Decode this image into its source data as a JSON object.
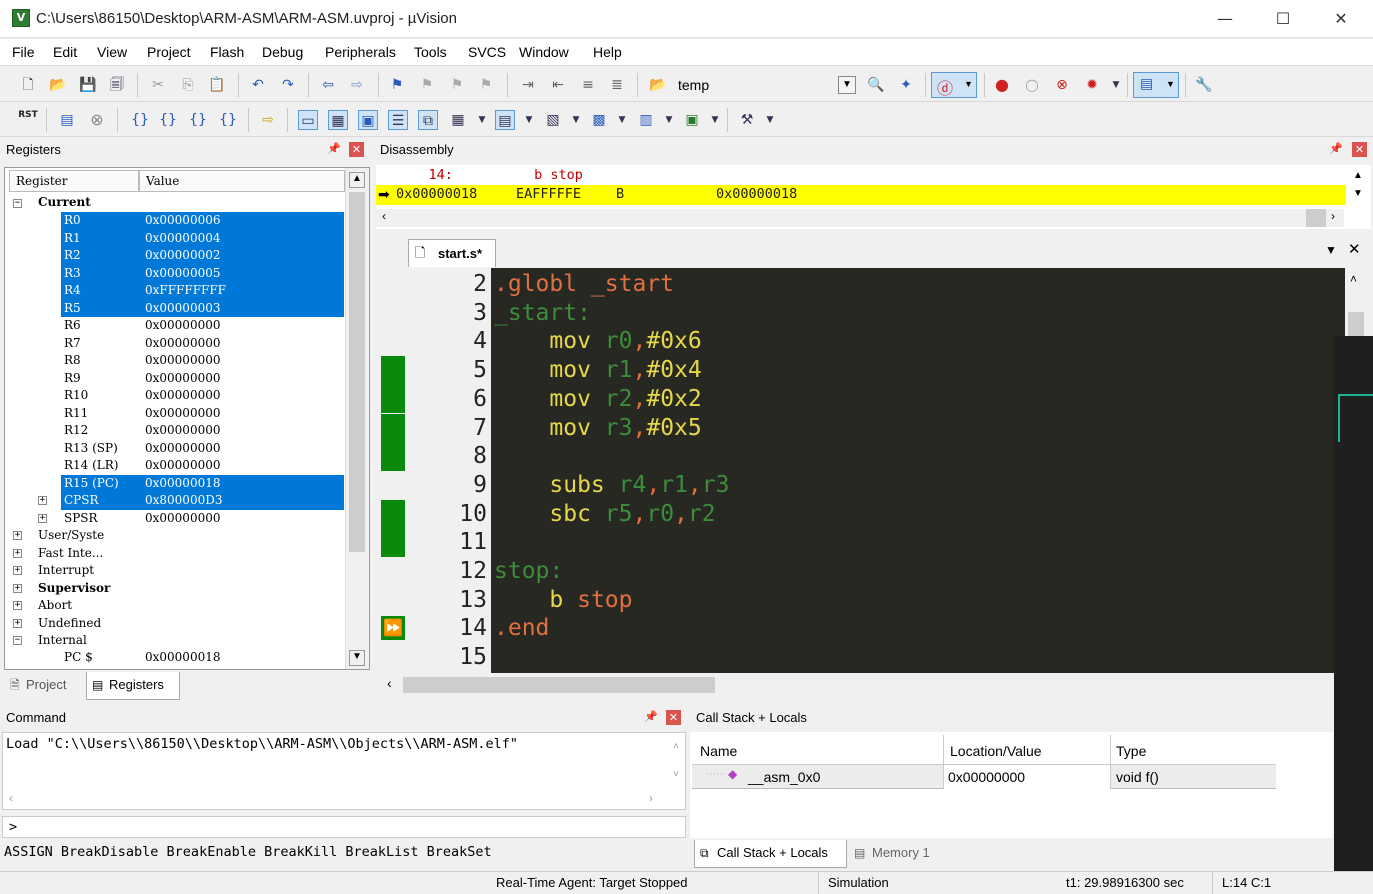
{
  "window": {
    "title": "C:\\Users\\86150\\Desktop\\ARM-ASM\\ARM-ASM.uvproj - µVision",
    "icon": "V"
  },
  "menu": [
    "File",
    "Edit",
    "View",
    "Project",
    "Flash",
    "Debug",
    "Peripherals",
    "Tools",
    "SVCS",
    "Window",
    "Help"
  ],
  "toolbar": {
    "target_combo": "temp"
  },
  "registers": {
    "title": "Registers",
    "col_register": "Register",
    "col_value": "Value",
    "current_label": "Current",
    "rows": [
      {
        "name": "R0",
        "value": "0x00000006",
        "selected": true
      },
      {
        "name": "R1",
        "value": "0x00000004",
        "selected": true
      },
      {
        "name": "R2",
        "value": "0x00000002",
        "selected": true
      },
      {
        "name": "R3",
        "value": "0x00000005",
        "selected": true
      },
      {
        "name": "R4",
        "value": "0xFFFFFFFF",
        "selected": true
      },
      {
        "name": "R5",
        "value": "0x00000003",
        "selected": true
      },
      {
        "name": "R6",
        "value": "0x00000000",
        "selected": false
      },
      {
        "name": "R7",
        "value": "0x00000000",
        "selected": false
      },
      {
        "name": "R8",
        "value": "0x00000000",
        "selected": false
      },
      {
        "name": "R9",
        "value": "0x00000000",
        "selected": false
      },
      {
        "name": "R10",
        "value": "0x00000000",
        "selected": false
      },
      {
        "name": "R11",
        "value": "0x00000000",
        "selected": false
      },
      {
        "name": "R12",
        "value": "0x00000000",
        "selected": false
      },
      {
        "name": "R13 (SP)",
        "value": "0x00000000",
        "selected": false
      },
      {
        "name": "R14 (LR)",
        "value": "0x00000000",
        "selected": false
      },
      {
        "name": "R15 (PC)",
        "value": "0x00000018",
        "selected": true
      },
      {
        "name": "CPSR",
        "value": "0x800000D3",
        "selected": true
      },
      {
        "name": "SPSR",
        "value": "0x00000000",
        "selected": false
      }
    ],
    "groups": [
      "User/Syste",
      "Fast Inte...",
      "Interrupt",
      "Supervisor",
      "Abort",
      "Undefined",
      "Internal"
    ],
    "pc_row": {
      "name": "PC  $",
      "value": "0x00000018"
    }
  },
  "left_tabs": {
    "project": "Project",
    "registers": "Registers"
  },
  "disassembly": {
    "title": "Disassembly",
    "line1": "    14:          b stop",
    "line2_addr": "0x00000018",
    "line2_opcode": "EAFFFFFE",
    "line2_instr": "B",
    "line2_target": "0x00000018"
  },
  "editor": {
    "tab": "start.s*",
    "lines": [
      {
        "n": "2",
        "tokens": [
          {
            "t": ".globl _start",
            "c": "#e07040"
          }
        ]
      },
      {
        "n": "3",
        "tokens": [
          {
            "t": "_start:",
            "c": "#3c8c3c"
          }
        ]
      },
      {
        "n": "4",
        "tokens": [
          {
            "t": "    mov ",
            "c": "#e6d84a"
          },
          {
            "t": "r0",
            "c": "#3c8c3c"
          },
          {
            "t": ",",
            "c": "#e07040"
          },
          {
            "t": "#0x6",
            "c": "#e6d84a"
          }
        ]
      },
      {
        "n": "5",
        "tokens": [
          {
            "t": "    mov ",
            "c": "#e6d84a"
          },
          {
            "t": "r1",
            "c": "#3c8c3c"
          },
          {
            "t": ",",
            "c": "#e07040"
          },
          {
            "t": "#0x4",
            "c": "#e6d84a"
          }
        ]
      },
      {
        "n": "6",
        "tokens": [
          {
            "t": "    mov ",
            "c": "#e6d84a"
          },
          {
            "t": "r2",
            "c": "#3c8c3c"
          },
          {
            "t": ",",
            "c": "#e07040"
          },
          {
            "t": "#0x2",
            "c": "#e6d84a"
          }
        ]
      },
      {
        "n": "7",
        "tokens": [
          {
            "t": "    mov ",
            "c": "#e6d84a"
          },
          {
            "t": "r3",
            "c": "#3c8c3c"
          },
          {
            "t": ",",
            "c": "#e07040"
          },
          {
            "t": "#0x5",
            "c": "#e6d84a"
          }
        ]
      },
      {
        "n": "8",
        "tokens": []
      },
      {
        "n": "9",
        "tokens": [
          {
            "t": "    subs ",
            "c": "#e6d84a"
          },
          {
            "t": "r4",
            "c": "#3c8c3c"
          },
          {
            "t": ",",
            "c": "#e07040"
          },
          {
            "t": "r1",
            "c": "#3c8c3c"
          },
          {
            "t": ",",
            "c": "#e07040"
          },
          {
            "t": "r3",
            "c": "#3c8c3c"
          }
        ]
      },
      {
        "n": "10",
        "tokens": [
          {
            "t": "    sbc ",
            "c": "#e6d84a"
          },
          {
            "t": "r5",
            "c": "#3c8c3c"
          },
          {
            "t": ",",
            "c": "#e07040"
          },
          {
            "t": "r0",
            "c": "#3c8c3c"
          },
          {
            "t": ",",
            "c": "#e07040"
          },
          {
            "t": "r2",
            "c": "#3c8c3c"
          }
        ]
      },
      {
        "n": "11",
        "tokens": []
      },
      {
        "n": "12",
        "tokens": [
          {
            "t": "stop:",
            "c": "#3c8c3c"
          }
        ]
      },
      {
        "n": "13",
        "tokens": [
          {
            "t": "    b ",
            "c": "#e6d84a"
          },
          {
            "t": "stop",
            "c": "#e07040"
          }
        ]
      },
      {
        "n": "14",
        "tokens": [
          {
            "t": ".end",
            "c": "#e07040"
          }
        ]
      },
      {
        "n": "15",
        "tokens": []
      }
    ]
  },
  "command": {
    "title": "Command",
    "output": "Load \"C:\\\\Users\\\\86150\\\\Desktop\\\\ARM-ASM\\\\Objects\\\\ARM-ASM.elf\"",
    "prompt": ">",
    "hints": "ASSIGN BreakDisable BreakEnable BreakKill BreakList BreakSet"
  },
  "callstack": {
    "title": "Call Stack + Locals",
    "col_name": "Name",
    "col_location": "Location/Value",
    "col_type": "Type",
    "row_name": "__asm_0x0",
    "row_location": "0x00000000",
    "row_type": "void f()",
    "tab_callstack": "Call Stack + Locals",
    "tab_memory": "Memory 1"
  },
  "status": {
    "agent": "Real-Time Agent: Target Stopped",
    "mode": "Simulation",
    "time": "t1: 29.98916300 sec",
    "position": "L:14 C:1"
  },
  "colors": {
    "selection": "#0078d7",
    "pc_highlight": "#ffff00",
    "coverage_green": "#008000",
    "editor_bg": "#272822"
  }
}
